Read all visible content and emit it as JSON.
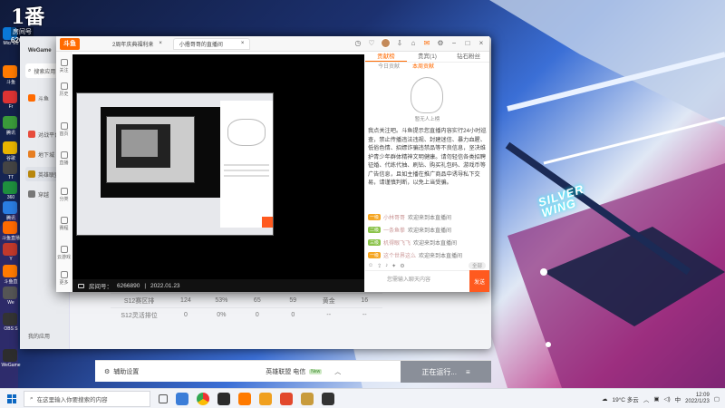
{
  "desktop": {
    "room_badge": {
      "big": "1番",
      "label": "房间号",
      "number": "6266890"
    },
    "wallpaper_text": [
      "SILVER",
      "WING"
    ],
    "icons": [
      "Micr Ed",
      "斗鱼",
      "Fr",
      "腾讯",
      "谷歌",
      "TT",
      "360",
      "腾讯",
      "斗鱼直播",
      "Y",
      "斗鱼直",
      "We",
      "OBS S",
      "WeGame"
    ]
  },
  "launcher": {
    "brand": "WeGame",
    "search_placeholder": "搜索应用",
    "sidebar": [
      "斗鱼",
      "对战平台",
      "地下城",
      "英雄联盟",
      "穿越"
    ],
    "recent": "我的应用",
    "stats_rows": [
      [
        "S12赛区排",
        "124",
        "53%",
        "65",
        "59",
        "黄金",
        "16"
      ],
      [
        "S12灵活排位",
        "0",
        "0%",
        "0",
        "0",
        "--",
        "--"
      ]
    ],
    "bottom_left": "辅助设置",
    "bottom_mid": "英雄联盟 电信",
    "bottom_badge": "New",
    "run_button": "正在运行..."
  },
  "app": {
    "logo": "斗鱼",
    "tabs": [
      {
        "label": "2周年庆典福利来",
        "active": false
      },
      {
        "label": "小撸哥哥的直播间",
        "active": true
      }
    ],
    "leftnav": [
      "关注",
      "历史",
      "首页",
      "直播",
      "分类",
      "赛程",
      "云游戏",
      "更多"
    ],
    "player_footer": {
      "room": "房间号：",
      "room_id": "6266890",
      "date": "2022.01.23"
    },
    "side": {
      "tabs": [
        "贡献榜",
        "贵宾(1)",
        "钻石粉丝"
      ],
      "sub_tabs": [
        "今日贡献",
        "本周贡献"
      ],
      "empty": "暂无人上榜",
      "notice": "我点关注吧。斗鱼提示您直播内容实行24小时巡查，禁止传播违法违规、封建迷信、暴力血腥、低俗色情、招嫖诈骗违禁品等不良信息，坚决维护青少年群体精神文明健康。请勿轻信各类招聘征婚、代练代抽、刷钻、购买礼包码、游戏币等广告信息，且如主播在推广商品中诱导私下交易，请谨慎判断，以免上当受骗。",
      "chat": [
        {
          "level": "一级",
          "user": "小林哥哥",
          "text": "欢迎来到本直播间"
        },
        {
          "level": "二级",
          "user": "一条鱼拳",
          "text": "欢迎来到本直播间"
        },
        {
          "level": "三级",
          "user": "机得眼飞飞",
          "text": "欢迎来到本直播间"
        },
        {
          "level": "一级",
          "user": "这个世界这么",
          "text": "欢迎来到本直播间"
        }
      ],
      "input_placeholder": "您需输入聊天内容",
      "pill": "全部",
      "send": "发送",
      "tool_label": "表情"
    }
  },
  "taskbar": {
    "search_placeholder": "在这里输入你要搜索的内容",
    "weather": "19°C 多云",
    "time": "12:09",
    "date": "2022/1/23"
  },
  "colors": {
    "accent": "#ff6a00",
    "taskbar": "#f1f3f8",
    "send": "#ff5a1f"
  }
}
